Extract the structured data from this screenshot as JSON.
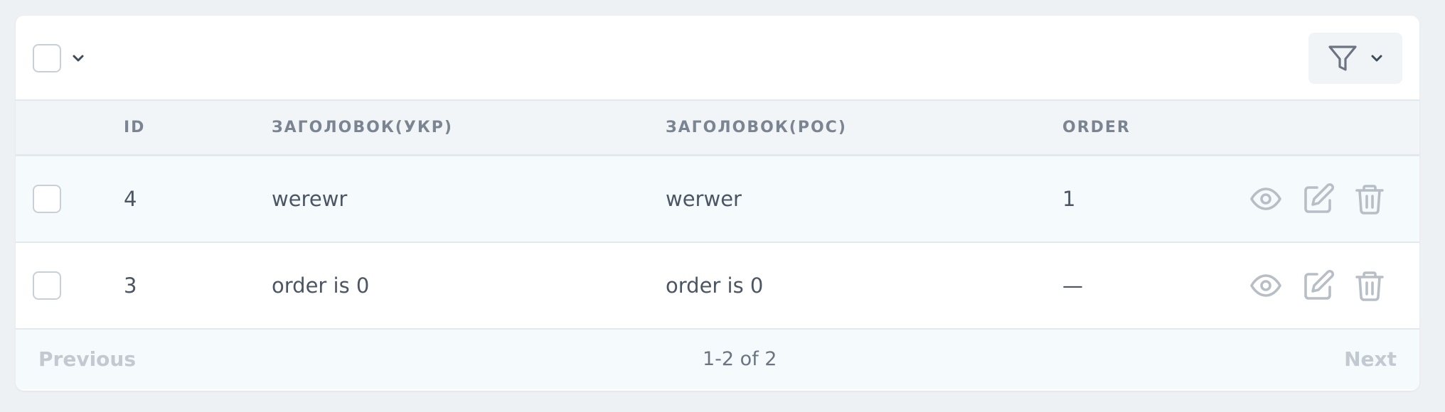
{
  "columns": [
    "ID",
    "ЗАГОЛОВОК(УКР)",
    "ЗАГОЛОВОК(РОС)",
    "ORDER"
  ],
  "rows": [
    {
      "id": "4",
      "title_ukr": "werewr",
      "title_ros": "werwer",
      "order": "1"
    },
    {
      "id": "3",
      "title_ukr": "order is 0",
      "title_ros": "order is 0",
      "order": "—"
    }
  ],
  "pagination": {
    "previous_label": "Previous",
    "info": "1-2 of 2",
    "next_label": "Next"
  },
  "icons": {
    "view": "eye-icon",
    "edit": "edit-icon",
    "delete": "trash-icon",
    "filter": "filter-icon",
    "chevron": "chevron-down-icon"
  },
  "colors": {
    "icon": "#b8bec6",
    "header_text": "#7b8591",
    "cell_text": "#4b5563",
    "disabled_nav": "#c3c9d0"
  }
}
